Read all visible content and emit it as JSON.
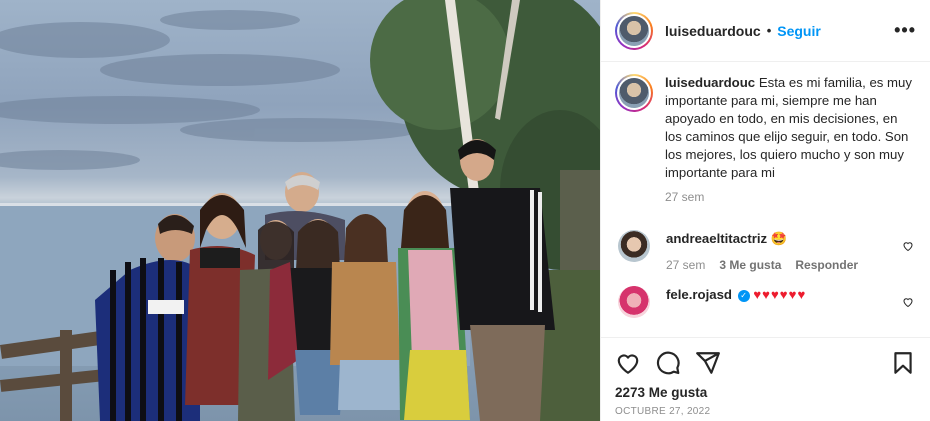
{
  "post": {
    "username": "luiseduardouc",
    "follow_label": "Seguir",
    "more_label": "•••",
    "caption": "Esta es mi familia, es muy importante para mi, siempre me han apoyado en todo, en mis decisiones, en los caminos que elijo seguir, en todo. Son los mejores, los quiero mucho y son muy importante para mi",
    "caption_age": "27 sem",
    "likes": "2273 Me gusta",
    "date": "OCTUBRE 27, 2022"
  },
  "comments": [
    {
      "username": "andreaeltitactriz",
      "text": "🤩",
      "age": "27 sem",
      "likes": "3 Me gusta",
      "reply_label": "Responder"
    },
    {
      "username": "fele.rojasd",
      "verified": "✓",
      "text": "♥♥♥♥♥♥"
    }
  ],
  "icons": {
    "like": "heart-icon",
    "comment": "comment-icon",
    "share": "share-icon",
    "save": "bookmark-icon"
  },
  "colors": {
    "follow": "#0095f6",
    "muted": "#8e8e8e",
    "hearts": "#ed1c2e"
  }
}
